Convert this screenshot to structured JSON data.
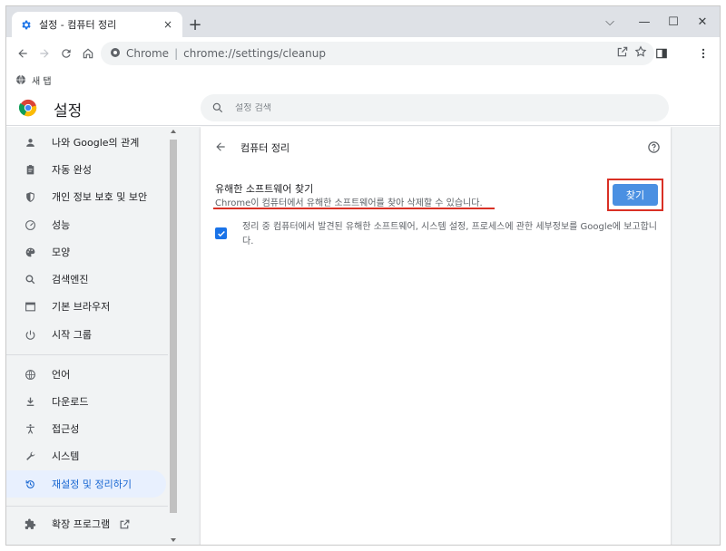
{
  "tab": {
    "title": "설정 - 컴퓨터 정리",
    "close": "×",
    "new_tab": "+"
  },
  "window_controls": {
    "minimize": "—",
    "maximize": "☐",
    "close": "✕",
    "chevron": "⌵"
  },
  "omnibox": {
    "site": "Chrome",
    "separator": "|",
    "url": "chrome://settings/cleanup"
  },
  "bookmarks": {
    "item": "새 탭"
  },
  "header": {
    "title": "설정",
    "search_placeholder": "설정 검색"
  },
  "sidebar": {
    "items": [
      {
        "label": "나와 Google의 관계",
        "icon": "person-icon"
      },
      {
        "label": "자동 완성",
        "icon": "clipboard-icon"
      },
      {
        "label": "개인 정보 보호 및 보안",
        "icon": "shield-icon"
      },
      {
        "label": "성능",
        "icon": "speedometer-icon"
      },
      {
        "label": "모양",
        "icon": "palette-icon"
      },
      {
        "label": "검색엔진",
        "icon": "search-icon"
      },
      {
        "label": "기본 브라우저",
        "icon": "browser-icon"
      },
      {
        "label": "시작 그룹",
        "icon": "power-icon"
      },
      {
        "label": "언어",
        "icon": "globe-icon"
      },
      {
        "label": "다운로드",
        "icon": "download-icon"
      },
      {
        "label": "접근성",
        "icon": "accessibility-icon"
      },
      {
        "label": "시스템",
        "icon": "wrench-icon"
      },
      {
        "label": "재설정 및 정리하기",
        "icon": "restore-icon"
      },
      {
        "label": "확장 프로그램",
        "icon": "puzzle-icon"
      }
    ]
  },
  "page": {
    "title": "컴퓨터 정리",
    "row_title": "유해한 소프트웨어 찾기",
    "row_desc": "Chrome이 컴퓨터에서 유해한 소프트웨어를 찾아 삭제할 수 있습니다.",
    "find_button": "찾기",
    "checkbox_label": "정리 중 컴퓨터에서 발견된 유해한 소프트웨어, 시스템 설정, 프로세스에 관한 세부정보를 Google에 보고합니다.",
    "checkbox_checked": true
  },
  "colors": {
    "accent": "#1a73e8",
    "active_bg": "#e8f0fe",
    "highlight": "#d93025",
    "button": "#4a90e2"
  }
}
